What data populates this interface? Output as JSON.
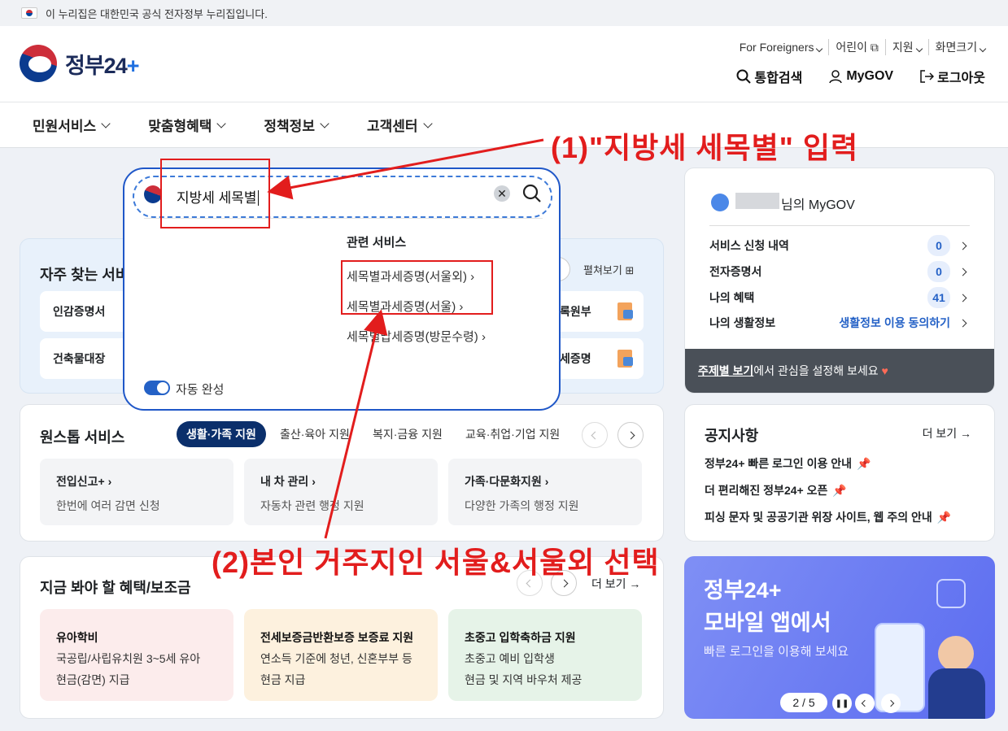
{
  "banner": {
    "text": "이 누리집은 대한민국 공식 전자정부 누리집입니다."
  },
  "logo": {
    "text": "정부24",
    "plus": "+"
  },
  "util": [
    "For Foreigners",
    "어린이",
    "지원",
    "화면크기"
  ],
  "top": {
    "search": "통합검색",
    "mygov": "MyGOV",
    "logout": "로그아웃"
  },
  "nav": [
    "민원서비스",
    "맞춤형혜택",
    "정책정보",
    "고객센터"
  ],
  "search": {
    "value": "지방세 세목별",
    "related_title": "관련 서비스",
    "related": [
      "세목별과세증명(서울외)",
      "세목별과세증명(서울)",
      "세목별납세증명(방문수령)"
    ],
    "autocomplete": "자동 완성"
  },
  "freq": {
    "title": "자주 찾는 서비",
    "expand": "펼쳐보기",
    "items": [
      "인감증명서",
      "건축물대장",
      "록원부",
      "세증명"
    ]
  },
  "onestop": {
    "title": "원스톱 서비스",
    "tabs": [
      "생활·가족 지원",
      "출산·육아 지원",
      "복지·금융 지원",
      "교육·취업·기업 지원"
    ],
    "boxes": [
      {
        "t": "전입신고+",
        "d": "한번에 여러 감면 신청"
      },
      {
        "t": "내 차 관리",
        "d": "자동차 관련 행정 지원"
      },
      {
        "t": "가족·다문화지원",
        "d": "다양한 가족의 행정 지원"
      }
    ]
  },
  "benefit": {
    "title": "지금 봐야 할 혜택/보조금",
    "more": "더 보기",
    "boxes": [
      {
        "t": "유아학비",
        "l1": "국공립/사립유치원 3~5세 유아",
        "l2": "현금(감면) 지급"
      },
      {
        "t": "전세보증금반환보증 보증료 지원",
        "l1": "연소득 기준에 청년, 신혼부부 등",
        "l2": "현금 지급"
      },
      {
        "t": "초중고 입학축하금 지원",
        "l1": "초중고 예비 입학생",
        "l2": "현금 및 지역 바우처 제공"
      }
    ]
  },
  "mygov": {
    "suffix": "님의 MyGOV",
    "rows": [
      {
        "label": "서비스 신청 내역",
        "count": "0"
      },
      {
        "label": "전자증명서",
        "count": "0"
      },
      {
        "label": "나의 혜택",
        "count": "41"
      },
      {
        "label": "나의 생활정보",
        "link": "생활정보 이용 동의하기"
      }
    ],
    "footer_link": "주제별 보기",
    "footer_text": "에서 관심을 설정해 보세요"
  },
  "notice": {
    "title": "공지사항",
    "more": "더 보기",
    "items": [
      "정부24+ 빠른 로그인 이용 안내",
      "더 편리해진 정부24+ 오픈",
      "피싱 문자 및 공공기관 위장 사이트, 웹 주의 안내"
    ]
  },
  "promo": {
    "l1": "정부24+",
    "l2": "모바일 앱에서",
    "l3": "빠른 로그인을 이용해 보세요",
    "page": "2 / 5"
  },
  "anno": {
    "a1": "(1)\"지방세 세목별\" 입력",
    "a2": "(2)본인 거주지인 서울&서울외 선택"
  }
}
